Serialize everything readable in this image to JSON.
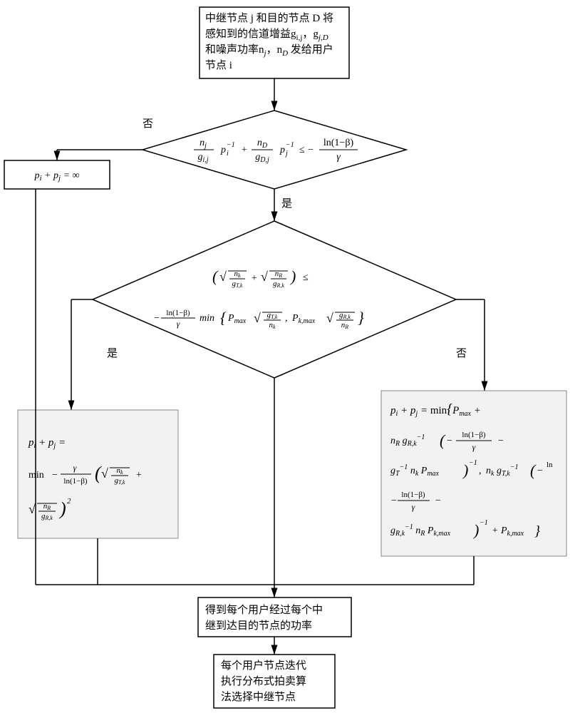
{
  "chart_data": {
    "type": "flowchart",
    "nodes": [
      {
        "id": "start",
        "shape": "rect",
        "text": "中继节点 j 和目的节点 D 将感知到的信道增益g_{i,j}，g_{j,D} 和噪声功率n_j，n_D 发给用户节点 i"
      },
      {
        "id": "cond1",
        "shape": "diamond",
        "text": "(n_j/g_{i,j}) p_i^{-1} + (n_D/g_{D,j}) p_j^{-1} ≤ − ln(1−β)/γ"
      },
      {
        "id": "infty",
        "shape": "rect",
        "text": "p_i + p_j = ∞"
      },
      {
        "id": "cond2",
        "shape": "diamond",
        "text": "(√(n_k/g_{T,k}) + √(n_R/g_{R,k})) ≤ −(ln(1−β)/γ) · min{ P_max √(g_{T,k}/n_k), P_{k,max} √(g_{R,k}/n_R) }"
      },
      {
        "id": "left_eq",
        "shape": "rect",
        "text": "p_i + p_j = min − (γ / ln(1−β)) (√(n_k/g_{T,k}) + √(n_R/g_{R,k}))^2"
      },
      {
        "id": "right_eq",
        "shape": "rect",
        "text": "p_i + p_j = min{ P_max + n_R g_{R,k}^{-1} ( −ln(1−β)/γ − g_T^{-1} n_k P_max )^{-1}, n_k g_{T,k}^{-1} ( −ln(1−β)/γ − g_{R,k}^{-1} n_R P_{k,max} )^{-1} + P_{k,max} }"
      },
      {
        "id": "power",
        "shape": "rect",
        "text": "得到每个用户经过每个中继到达目的节点的功率"
      },
      {
        "id": "auction",
        "shape": "rect",
        "text": "每个用户节点迭代执行分布式拍卖算法选择中继节点"
      }
    ],
    "edges": [
      {
        "from": "start",
        "to": "cond1"
      },
      {
        "from": "cond1",
        "to": "infty",
        "label": "否"
      },
      {
        "from": "cond1",
        "to": "cond2",
        "label": "是"
      },
      {
        "from": "cond2",
        "to": "left_eq",
        "label": "是"
      },
      {
        "from": "cond2",
        "to": "right_eq",
        "label": "否"
      },
      {
        "from": "infty",
        "to": "power"
      },
      {
        "from": "left_eq",
        "to": "power"
      },
      {
        "from": "right_eq",
        "to": "power"
      },
      {
        "from": "power",
        "to": "auction"
      }
    ]
  },
  "labels": {
    "yes": "是",
    "no": "否"
  },
  "boxes": {
    "start_l1": "中继节点 j 和目的节点 D 将",
    "start_l2": "感知到的信道增益g",
    "start_l2b": "i,j",
    "start_l2c": "，g",
    "start_l2d": "j,D",
    "start_l3": "和噪声功率n",
    "start_l3b": "j",
    "start_l3c": "，n",
    "start_l3d": "D",
    "start_l3e": " 发给用户",
    "start_l4": "节点 i",
    "infty": "pᵢ + pⱼ = ∞",
    "power_l1": "得到每个用户经过每个中",
    "power_l2": "继到达目的节点的功率",
    "auction_l1": "每个用户节点迭代",
    "auction_l2": "执行分布式拍卖算",
    "auction_l3": "法选择中继节点"
  }
}
